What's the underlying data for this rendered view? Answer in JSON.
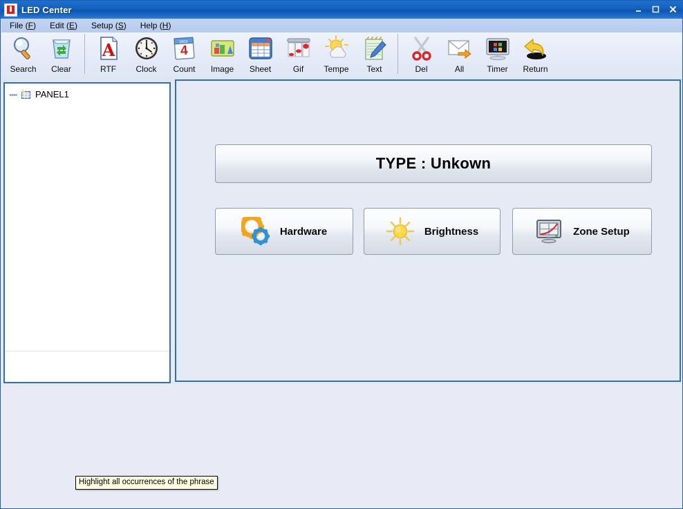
{
  "window": {
    "title": "LED Center",
    "icon": "app-logo-icon",
    "controls": {
      "minimize": "minimize-icon",
      "maximize": "maximize-icon",
      "close": "close-icon"
    }
  },
  "menubar": {
    "items": [
      {
        "label": "File (F)",
        "text": "File (",
        "accel": "F",
        "tail": ")"
      },
      {
        "label": "Edit (E)",
        "text": "Edit (",
        "accel": "E",
        "tail": ")"
      },
      {
        "label": "Setup (S)",
        "text": "Setup (",
        "accel": "S",
        "tail": ")"
      },
      {
        "label": "Help (H)",
        "text": "Help (",
        "accel": "H",
        "tail": ")"
      }
    ]
  },
  "toolbar": {
    "items": [
      {
        "label": "Search",
        "icon": "magnifier-icon"
      },
      {
        "label": "Clear",
        "icon": "recycle-icon"
      },
      {
        "label": "RTF",
        "icon": "rtf-document-icon"
      },
      {
        "label": "Clock",
        "icon": "clock-icon"
      },
      {
        "label": "Count",
        "icon": "calendar-icon"
      },
      {
        "label": "Image",
        "icon": "image-icon"
      },
      {
        "label": "Sheet",
        "icon": "spreadsheet-icon"
      },
      {
        "label": "Gif",
        "icon": "gif-animation-icon"
      },
      {
        "label": "Tempe",
        "icon": "weather-temperature-icon"
      },
      {
        "label": "Text",
        "icon": "notepad-pen-icon"
      },
      {
        "label": "Del",
        "icon": "scissors-icon"
      },
      {
        "label": "All",
        "icon": "envelope-send-icon"
      },
      {
        "label": "Timer",
        "icon": "monitor-timer-icon"
      },
      {
        "label": "Return",
        "icon": "undo-arrow-icon"
      }
    ],
    "separators_after": [
      "Clear",
      "Text"
    ]
  },
  "tree": {
    "nodes": [
      {
        "label": "PANEL1",
        "icon": "panel-node-icon"
      }
    ]
  },
  "content": {
    "type_bar": {
      "text": "TYPE : Unkown"
    },
    "buttons": [
      {
        "id": "hardware",
        "label": "Hardware",
        "icon": "gears-icon"
      },
      {
        "id": "brightness",
        "label": "Brightness",
        "icon": "sun-icon"
      },
      {
        "id": "zone",
        "label": "Zone Setup",
        "icon": "monitor-zone-icon"
      }
    ]
  },
  "tooltip": {
    "text": "Highlight all occurrences of the phrase"
  },
  "colors": {
    "titlebar_blue": "#1460be",
    "menubar_blue": "#bdd0ef",
    "toolbar_bg": "#e6ecf8",
    "panel_border": "#2f6fbe",
    "content_bg": "#e6eaf5",
    "window_bg": "#e8ebf5",
    "tooltip_bg": "#ffffe1"
  }
}
